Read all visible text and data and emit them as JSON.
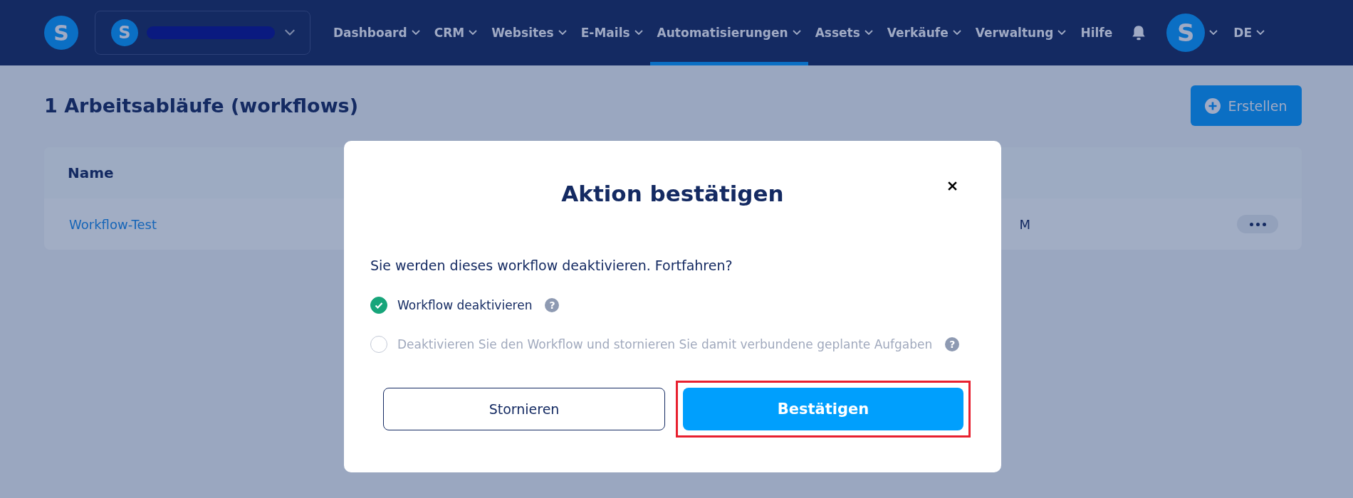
{
  "navbar": {
    "logo": "S",
    "account": {
      "avatar": "S",
      "redacted": true
    },
    "menu": [
      {
        "label": "Dashboard",
        "dropdown": true,
        "selected": false
      },
      {
        "label": "CRM",
        "dropdown": true,
        "selected": false
      },
      {
        "label": "Websites",
        "dropdown": true,
        "selected": false
      },
      {
        "label": "E-Mails",
        "dropdown": true,
        "selected": false
      },
      {
        "label": "Automatisierungen",
        "dropdown": true,
        "selected": true
      },
      {
        "label": "Assets",
        "dropdown": true,
        "selected": false
      },
      {
        "label": "Verkäufe",
        "dropdown": true,
        "selected": false
      },
      {
        "label": "Verwaltung",
        "dropdown": true,
        "selected": false
      },
      {
        "label": "Hilfe",
        "dropdown": false,
        "selected": false
      }
    ],
    "user_avatar": "S",
    "language": "DE"
  },
  "page": {
    "title": "1 Arbeitsabläufe (workflows)",
    "create_button": "Erstellen",
    "table": {
      "columns": [
        "Name"
      ],
      "rows": [
        {
          "name": "Workflow-Test",
          "column_2": "M"
        }
      ]
    }
  },
  "dialog": {
    "title": "Aktion bestätigen",
    "message": "Sie werden dieses workflow deaktivieren. Fortfahren?",
    "options": [
      {
        "label": "Workflow deaktivieren",
        "selected": true,
        "help": "?"
      },
      {
        "label": "Deaktivieren Sie den Workflow und stornieren Sie damit verbundene geplante Aufgaben",
        "selected": false,
        "help": "?"
      }
    ],
    "cancel_button": "Stornieren",
    "confirm_button": {
      "label": "Bestätigen",
      "highlighted": true
    }
  }
}
